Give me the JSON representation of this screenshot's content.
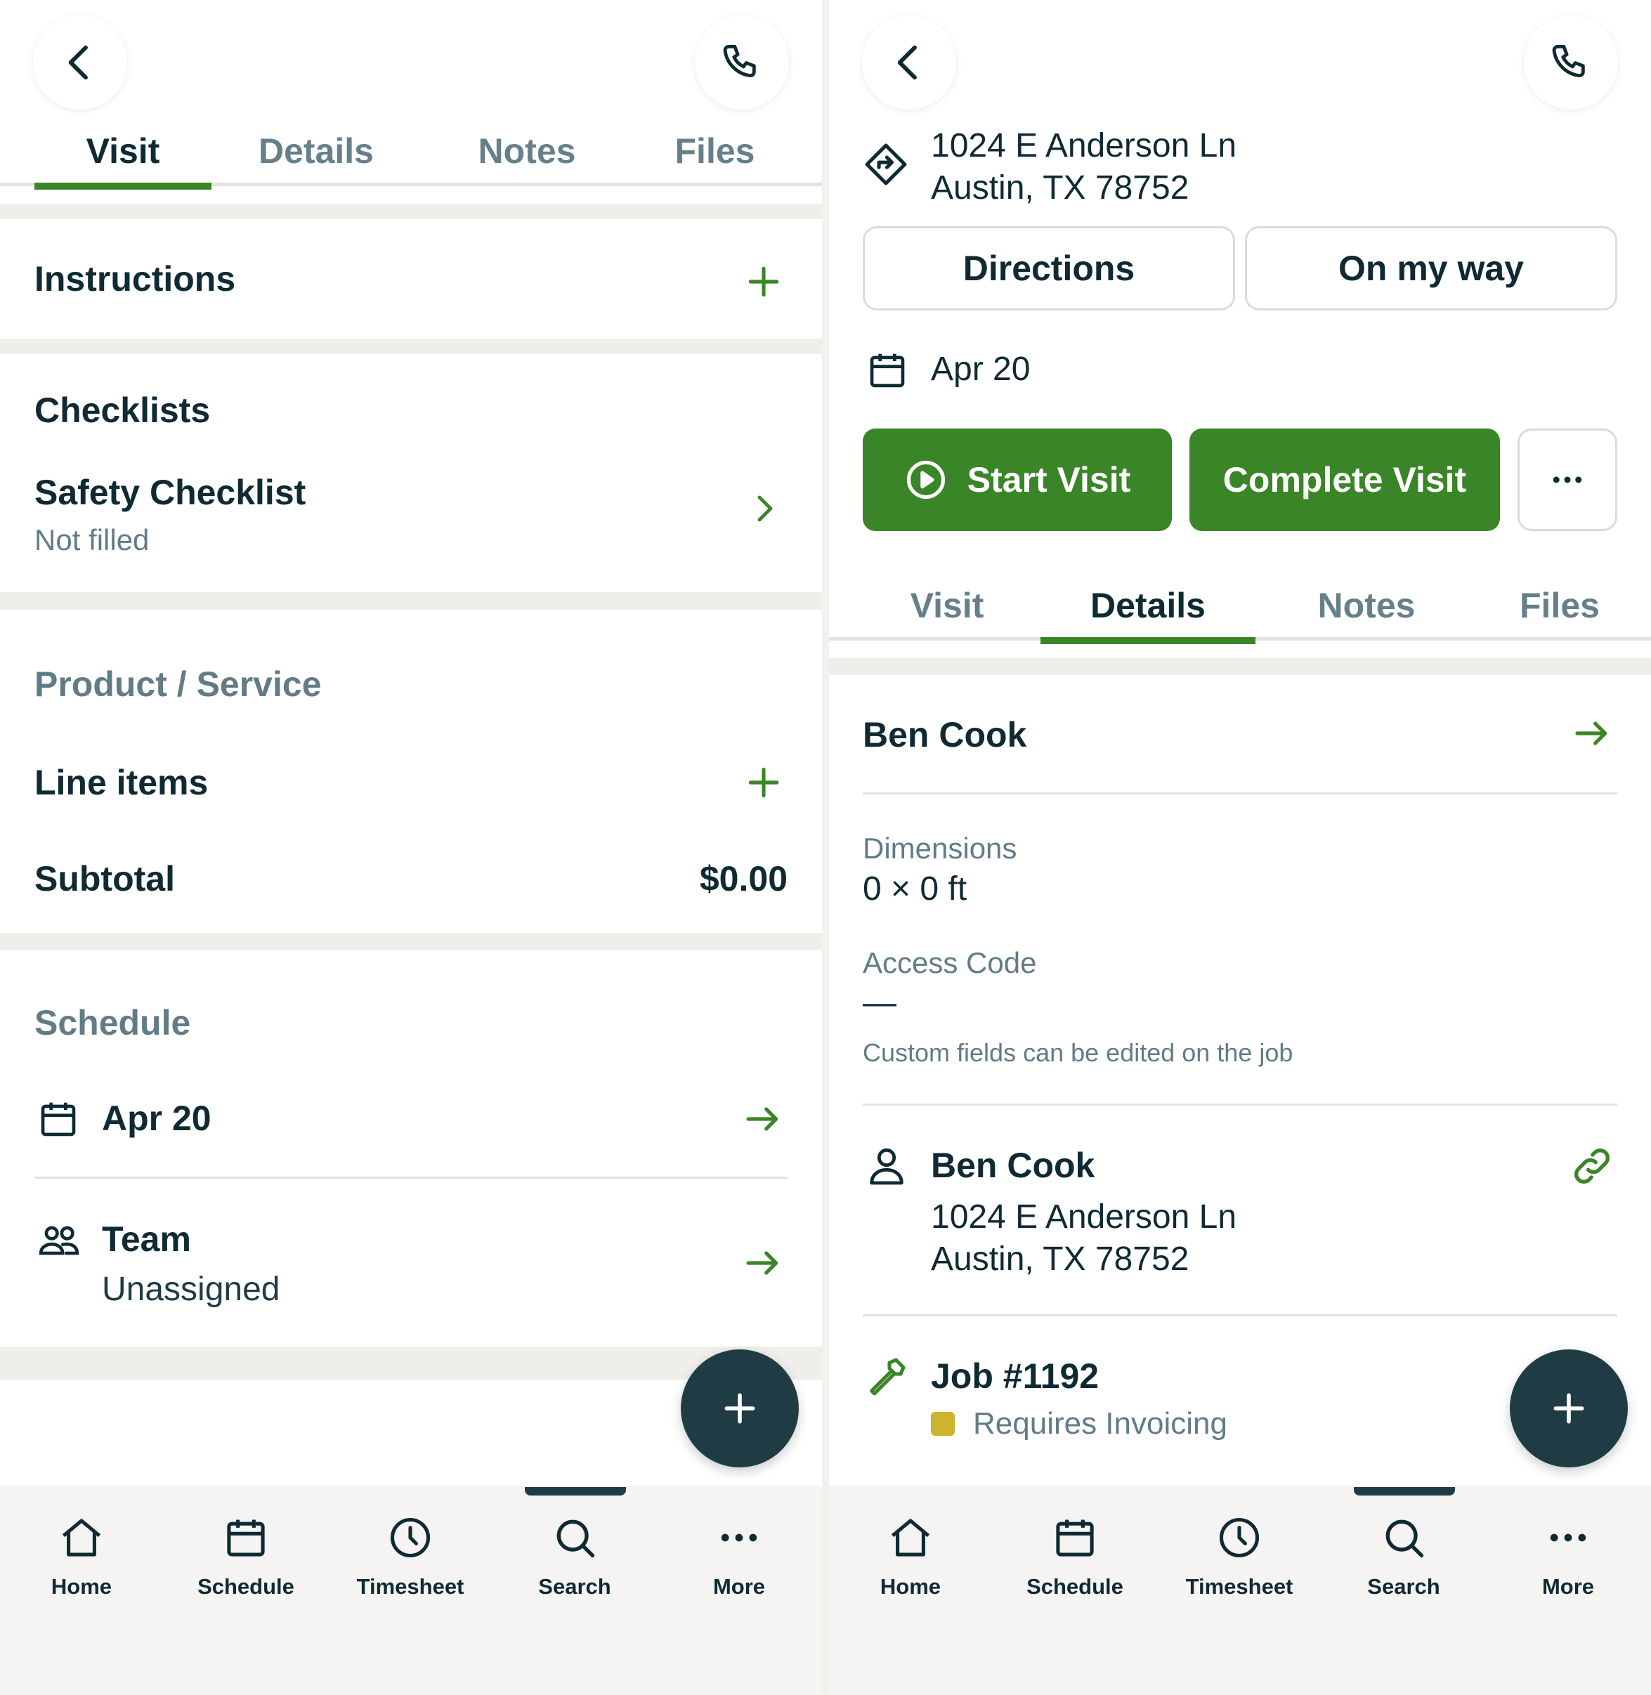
{
  "left": {
    "tabs": [
      {
        "label": "Visit",
        "active": true
      },
      {
        "label": "Details",
        "active": false
      },
      {
        "label": "Notes",
        "active": false
      },
      {
        "label": "Files",
        "active": false
      }
    ],
    "instructions": {
      "title": "Instructions"
    },
    "checklists": {
      "title": "Checklists",
      "item_title": "Safety Checklist",
      "item_status": "Not filled"
    },
    "product_service": {
      "title": "Product / Service",
      "line_items": "Line items",
      "subtotal_label": "Subtotal",
      "subtotal_value": "$0.00"
    },
    "schedule": {
      "title": "Schedule",
      "date": "Apr 20",
      "team_label": "Team",
      "team_value": "Unassigned"
    }
  },
  "right": {
    "address": {
      "line1": "1024 E Anderson Ln",
      "line2": "Austin, TX 78752"
    },
    "directions_label": "Directions",
    "on_my_way_label": "On my way",
    "date": "Apr 20",
    "start_visit_label": "Start Visit",
    "complete_visit_label": "Complete Visit",
    "tabs": [
      {
        "label": "Visit",
        "active": false
      },
      {
        "label": "Details",
        "active": true
      },
      {
        "label": "Notes",
        "active": false
      },
      {
        "label": "Files",
        "active": false
      }
    ],
    "client_name": "Ben Cook",
    "custom_fields": [
      {
        "label": "Dimensions",
        "value": "0 × 0 ft"
      },
      {
        "label": "Access Code",
        "value": "—"
      }
    ],
    "custom_fields_note": "Custom fields can be edited on the job",
    "contact": {
      "name": "Ben Cook",
      "address_line1": "1024 E Anderson Ln",
      "address_line2": "Austin, TX 78752"
    },
    "job": {
      "title": "Job #1192",
      "status": "Requires Invoicing",
      "status_color": "#cdb42f"
    }
  },
  "bottom_nav": {
    "items": [
      {
        "label": "Home",
        "icon": "home-icon"
      },
      {
        "label": "Schedule",
        "icon": "calendar-icon"
      },
      {
        "label": "Timesheet",
        "icon": "clock-icon"
      },
      {
        "label": "Search",
        "icon": "search-icon"
      },
      {
        "label": "More",
        "icon": "more-icon"
      }
    ],
    "active": "Search"
  },
  "colors": {
    "accent_green": "#3a8527",
    "text_dark": "#0f2a33",
    "text_muted": "#627c86",
    "fab": "#1f3c45",
    "band": "#efeeea"
  }
}
